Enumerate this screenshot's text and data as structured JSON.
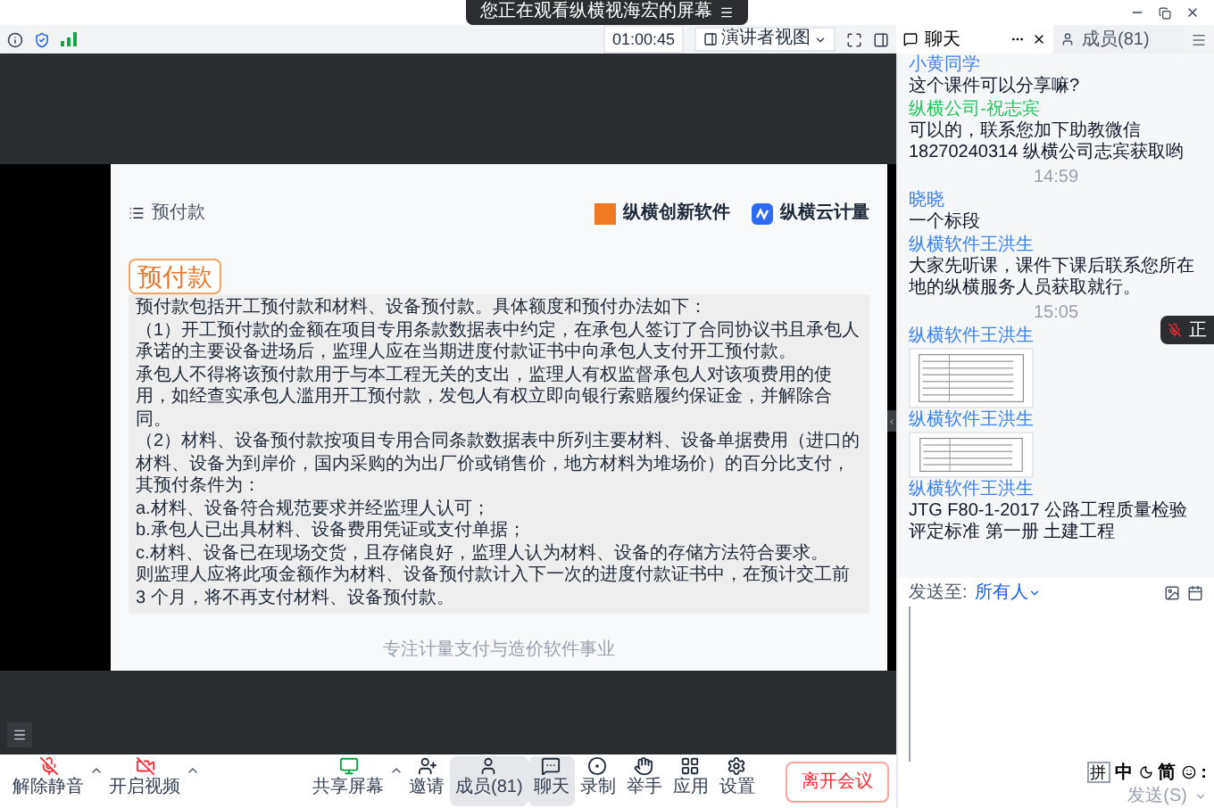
{
  "banner": {
    "text": "您正在观看纵横视海宏的屏幕"
  },
  "toolbar": {
    "timer": "01:00:45",
    "view_mode": "演讲者视图"
  },
  "side_tabs": [
    {
      "label": "聊天",
      "selected": true
    },
    {
      "label": "成员(81)",
      "selected": false
    }
  ],
  "slide": {
    "header": "预付款",
    "brands": [
      {
        "name": "纵横创新软件",
        "kind": "square"
      },
      {
        "name": "纵横云计量",
        "kind": "badge"
      }
    ],
    "title": "预付款",
    "paragraphs": [
      "预付款包括开工预付款和材料、设备预付款。具体额度和预付办法如下：",
      "（1）开工预付款的金额在项目专用条款数据表中约定，在承包人签订了合同协议书且承包人承诺的主要设备进场后，监理人应在当期进度付款证书中向承包人支付开工预付款。",
      "承包人不得将该预付款用于与本工程无关的支出，监理人有权监督承包人对该项费用的使用，如经查实承包人滥用开工预付款，发包人有权立即向银行索赔履约保证金，并解除合同。",
      "（2）材料、设备预付款按项目专用合同条款数据表中所列主要材料、设备单据费用（进口的材料、设备为到岸价，国内采购的为出厂价或销售价，地方材料为堆场价）的百分比支付，其预付条件为：",
      "a.材料、设备符合规范要求并经监理人认可；",
      "b.承包人已出具材料、设备费用凭证或支付单据；",
      "c.材料、设备已在现场交货，且存储良好，监理人认为材料、设备的存储方法符合要求。",
      "则监理人应将此项金额作为材料、设备预付款计入下一次的进度付款证书中，在预计交工前 3 个月，将不再支付材料、设备预付款。"
    ],
    "footer": "专注计量支付与造价软件事业"
  },
  "chat": {
    "messages": [
      {
        "kind": "text",
        "sender": "小黄同学",
        "color": "#3b82f6",
        "text": "这个课件可以分享嘛?"
      },
      {
        "kind": "text",
        "sender": "纵横公司-祝志宾",
        "color": "#22c55e",
        "text": "可以的，联系您加下助教微信18270240314 纵横公司志宾获取哟"
      },
      {
        "kind": "time",
        "text": "14:59"
      },
      {
        "kind": "text",
        "sender": "晓晓",
        "color": "#3b82f6",
        "text": "一个标段"
      },
      {
        "kind": "text",
        "sender": "纵横软件王洪生",
        "color": "#3b82f6",
        "text": "大家先听课，课件下课后联系您所在地的纵横服务人员获取就行。"
      },
      {
        "kind": "time",
        "text": "15:05"
      },
      {
        "kind": "image",
        "sender": "纵横软件王洪生",
        "color": "#3b82f6"
      },
      {
        "kind": "image",
        "sender": "纵横软件王洪生",
        "color": "#3b82f6"
      },
      {
        "kind": "text",
        "sender": "纵横软件王洪生",
        "color": "#3b82f6",
        "text": "JTG F80-1-2017 公路工程质量检验评定标准 第一册 土建工程"
      }
    ],
    "send_to": {
      "label": "发送至:",
      "target": "所有人"
    },
    "ime": [
      "拼",
      "中",
      "简",
      ":"
    ],
    "send_button": "发送(S)"
  },
  "floating": {
    "text": "正"
  },
  "controls": [
    {
      "label": "解除静音",
      "caret": true,
      "selected": false
    },
    {
      "label": "开启视频",
      "caret": true,
      "selected": false
    },
    {
      "label": "共享屏幕",
      "caret": true,
      "selected": false
    },
    {
      "label": "邀请",
      "caret": false,
      "selected": false
    },
    {
      "label": "成员(81)",
      "caret": false,
      "selected": true
    },
    {
      "label": "聊天",
      "caret": false,
      "selected": true
    },
    {
      "label": "录制",
      "caret": false,
      "selected": false
    },
    {
      "label": "举手",
      "caret": false,
      "selected": false
    },
    {
      "label": "应用",
      "caret": false,
      "selected": false
    },
    {
      "label": "设置",
      "caret": false,
      "selected": false
    }
  ],
  "leave_button": "离开会议"
}
